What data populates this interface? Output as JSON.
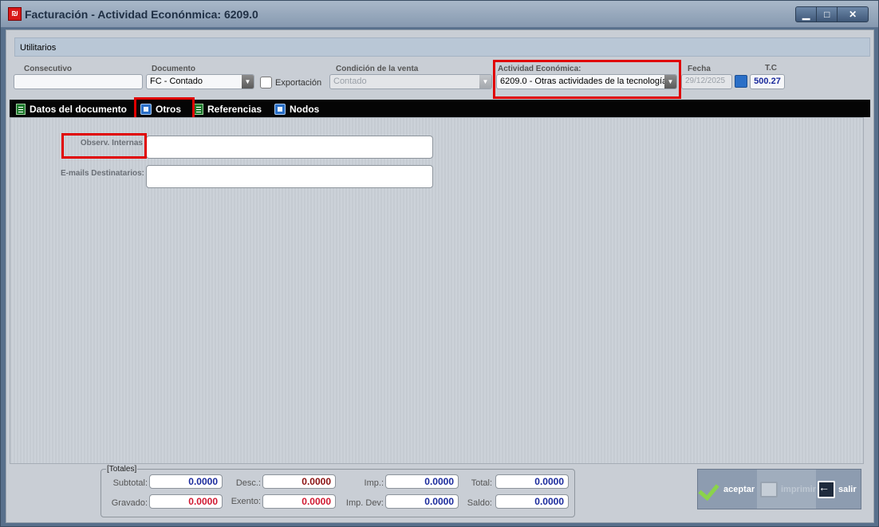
{
  "window": {
    "title": "Facturación - Actividad Econónmica: 6209.0",
    "controls": {
      "minimize": "▁",
      "maximize": "□",
      "close": "✕"
    }
  },
  "utilitarios": {
    "label": "Utilitarios"
  },
  "header": {
    "consecutivo": {
      "label": "Consecutivo",
      "value": ""
    },
    "documento": {
      "label": "Documento",
      "value": "FC - Contado"
    },
    "exportacion": {
      "label": "Exportación",
      "checked": false
    },
    "condicion": {
      "label": "Condición de la venta",
      "value": "Contado"
    },
    "actividad": {
      "label": "Actividad Económica:",
      "value": "6209.0 - Otras actividades de la tecnología"
    },
    "fecha": {
      "label": "Fecha",
      "value": "29/12/2025"
    },
    "tc": {
      "label": "T.C",
      "value": "500.27"
    }
  },
  "tabs": [
    {
      "label": "Datos del documento",
      "icon": "document-green-icon"
    },
    {
      "label": "Otros",
      "icon": "window-blue-icon"
    },
    {
      "label": "Referencias",
      "icon": "document-green-icon"
    },
    {
      "label": "Nodos",
      "icon": "window-blue-icon"
    }
  ],
  "form": {
    "observ_label": "Observ. Internas",
    "observ_value": "",
    "emails_label": "E-mails Destinatarios:",
    "emails_value": ""
  },
  "totals": {
    "title": "[Totales]",
    "subtotal": {
      "label": "Subtotal:",
      "value": "0.0000"
    },
    "desc": {
      "label": "Desc.:",
      "value": "0.0000"
    },
    "imp": {
      "label": "Imp.:",
      "value": "0.0000"
    },
    "total": {
      "label": "Total:",
      "value": "0.0000"
    },
    "gravado": {
      "label": "Gravado:",
      "value": "0.0000"
    },
    "exento": {
      "label": "Exento:",
      "value": "0.0000"
    },
    "imp_dev": {
      "label": "Imp. Dev:",
      "value": "0.0000"
    },
    "saldo": {
      "label": "Saldo:",
      "value": "0.0000"
    }
  },
  "actions": {
    "aceptar": "aceptar",
    "imprimir": "imprimir",
    "salir": "salir"
  },
  "colors": {
    "highlight": "#e00000",
    "tab_bar": "#050505",
    "value_blue": "#1a2a9c",
    "value_red": "#d01830"
  }
}
